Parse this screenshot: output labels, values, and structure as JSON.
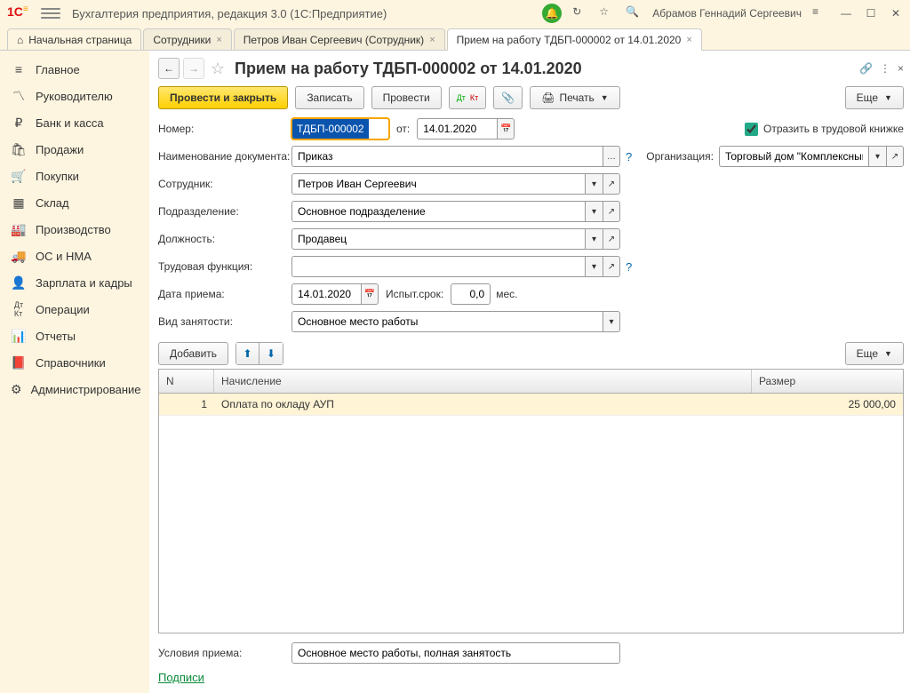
{
  "app": {
    "title": "Бухгалтерия предприятия, редакция 3.0  (1С:Предприятие)",
    "user": "Абрамов Геннадий Сергеевич"
  },
  "tabs": {
    "home": "Начальная страница",
    "items": [
      {
        "label": "Сотрудники"
      },
      {
        "label": "Петров Иван Сергеевич (Сотрудник)"
      },
      {
        "label": "Прием на работу ТДБП-000002 от 14.01.2020",
        "active": true
      }
    ]
  },
  "nav": {
    "items": [
      "Главное",
      "Руководителю",
      "Банк и касса",
      "Продажи",
      "Покупки",
      "Склад",
      "Производство",
      "ОС и НМА",
      "Зарплата и кадры",
      "Операции",
      "Отчеты",
      "Справочники",
      "Администрирование"
    ]
  },
  "page": {
    "title": "Прием на работу ТДБП-000002 от 14.01.2020",
    "actions": {
      "post_close": "Провести и закрыть",
      "save": "Записать",
      "post": "Провести",
      "print": "Печать",
      "more": "Еще"
    },
    "fields": {
      "number_label": "Номер:",
      "number_value": "ТДБП-000002",
      "from_label": "от:",
      "date_value": "14.01.2020",
      "reflect_label": "Отразить в трудовой книжке",
      "docname_label": "Наименование документа:",
      "docname_value": "Приказ",
      "org_label": "Организация:",
      "org_value": "Торговый дом \"Комплексный\"",
      "employee_label": "Сотрудник:",
      "employee_value": "Петров Иван Сергеевич",
      "department_label": "Подразделение:",
      "department_value": "Основное подразделение",
      "position_label": "Должность:",
      "position_value": "Продавец",
      "func_label": "Трудовая функция:",
      "func_value": "",
      "hire_date_label": "Дата приема:",
      "hire_date_value": "14.01.2020",
      "trial_label": "Испыт.срок:",
      "trial_value": "0,0",
      "trial_unit": "мес.",
      "emp_type_label": "Вид занятости:",
      "emp_type_value": "Основное место работы",
      "conditions_label": "Условия приема:",
      "conditions_value": "Основное место работы, полная занятость",
      "add": "Добавить",
      "signs": "Подписи"
    },
    "grid": {
      "cols": {
        "n": "N",
        "name": "Начисление",
        "size": "Размер"
      },
      "rows": [
        {
          "n": "1",
          "name": "Оплата по окладу АУП",
          "size": "25 000,00"
        }
      ]
    }
  }
}
